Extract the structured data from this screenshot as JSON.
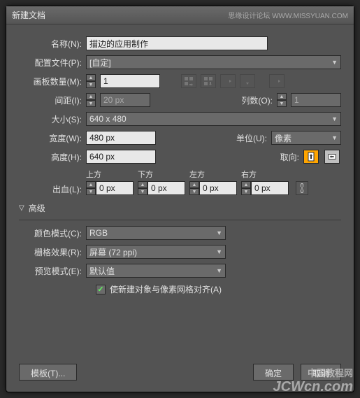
{
  "title": "新建文档",
  "title_right": "思缘设计论坛  WWW.MISSYUAN.COM",
  "name": {
    "label": "名称(N):",
    "value": "描边的应用制作"
  },
  "profile": {
    "label": "配置文件(P):",
    "value": "[自定]"
  },
  "artboards": {
    "label": "画板数量(M):",
    "value": "1"
  },
  "spacing": {
    "label": "间距(I):",
    "value": "20 px"
  },
  "columns": {
    "label": "列数(O):",
    "value": "1"
  },
  "size": {
    "label": "大小(S):",
    "value": "640 x 480"
  },
  "width": {
    "label": "宽度(W):",
    "value": "480 px"
  },
  "units": {
    "label": "单位(U):",
    "value": "像素"
  },
  "height": {
    "label": "高度(H):",
    "value": "640 px"
  },
  "orient": {
    "label": "取向:"
  },
  "bleed": {
    "label": "出血(L):",
    "top": {
      "hdr": "上方",
      "value": "0 px"
    },
    "bottom": {
      "hdr": "下方",
      "value": "0 px"
    },
    "left": {
      "hdr": "左方",
      "value": "0 px"
    },
    "right": {
      "hdr": "右方",
      "value": "0 px"
    }
  },
  "advanced": "高级",
  "colormode": {
    "label": "颜色模式(C):",
    "value": "RGB"
  },
  "raster": {
    "label": "栅格效果(R):",
    "value": "屏幕 (72 ppi)"
  },
  "preview": {
    "label": "预览模式(E):",
    "value": "默认值"
  },
  "align": "使新建对象与像素网格对齐(A)",
  "templates": "模板(T)...",
  "ok": "确定",
  "cancel": "取消",
  "watermark_cn": "中国教程网",
  "watermark_en": "JCWcn.com"
}
